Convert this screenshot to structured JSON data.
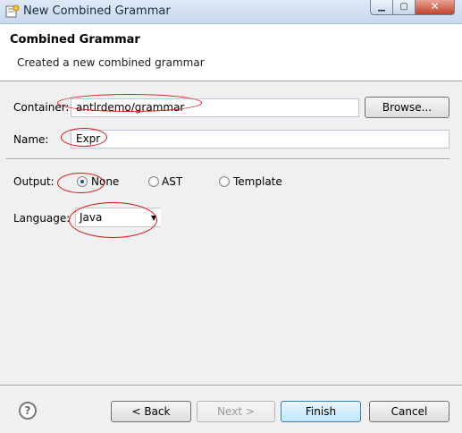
{
  "window": {
    "title": "New Combined Grammar",
    "icon": "eclipse-wizard-icon",
    "controls": {
      "minimize": "▁",
      "maximize": "▢",
      "close": "✕"
    }
  },
  "header": {
    "title": "Combined Grammar",
    "description": "Created a new combined grammar"
  },
  "form": {
    "container": {
      "label": "Container:",
      "value": "antlrdemo/grammar",
      "browse_label": "Browse..."
    },
    "name": {
      "label": "Name:",
      "value": "Expr"
    },
    "output": {
      "label": "Output:",
      "options": [
        {
          "label": "None",
          "selected": true
        },
        {
          "label": "AST",
          "selected": false
        },
        {
          "label": "Template",
          "selected": false
        }
      ]
    },
    "language": {
      "label": "Language:",
      "selected": "Java"
    }
  },
  "footer": {
    "help_icon": "?",
    "back_label": "< Back",
    "next_label": "Next >",
    "finish_label": "Finish",
    "cancel_label": "Cancel"
  },
  "colors": {
    "annotation": "#dd1111",
    "title_bar": "#c9d9ee",
    "dialog_bg": "#f0f0f0"
  }
}
